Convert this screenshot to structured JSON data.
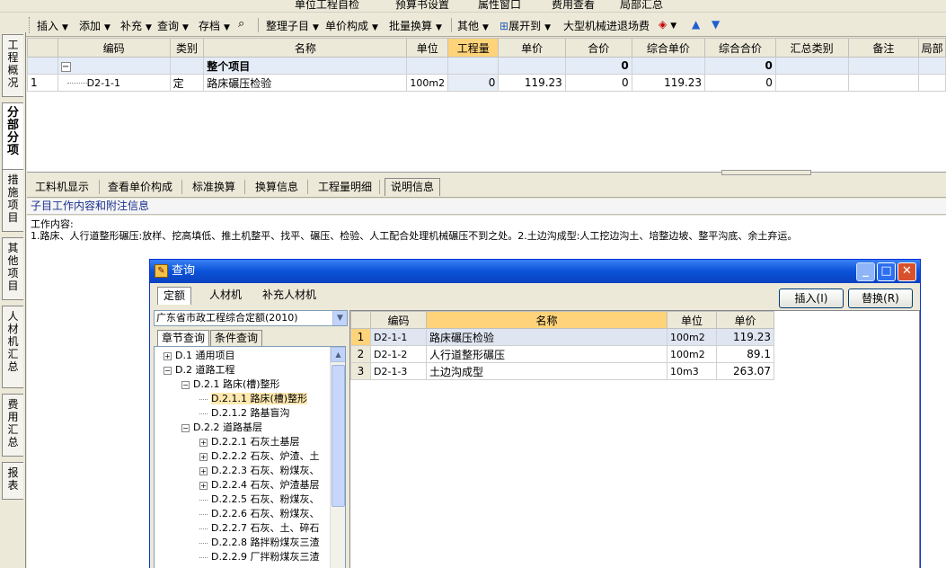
{
  "top_toolbar": {
    "items": [
      "单位工程自检",
      "预算书设置",
      "属性窗口",
      "费用查看",
      "局部汇总"
    ]
  },
  "main_toolbar": {
    "insert": "插入",
    "add": "添加",
    "supplement": "补充",
    "query": "查询",
    "archive": "存档",
    "organize": "整理子目",
    "unit_price_composition": "单价构成",
    "batch_convert": "批量换算",
    "other": "其他",
    "expand_to": "展开到",
    "machinery_fee": "大型机械进退场费"
  },
  "left_tabs": [
    {
      "label": "工程概况"
    },
    {
      "label": "分部分项"
    },
    {
      "label": "措施项目"
    },
    {
      "label": "其他项目"
    },
    {
      "label": "人材机汇总"
    },
    {
      "label": "费用汇总"
    },
    {
      "label": "报表"
    }
  ],
  "main_grid": {
    "columns": [
      "编码",
      "类别",
      "名称",
      "单位",
      "工程量",
      "单价",
      "合价",
      "综合单价",
      "综合合价",
      "汇总类别",
      "备注",
      "局部"
    ],
    "group_row": {
      "name": "整个项目",
      "total": "0",
      "comp_total": "0",
      "toggle": "−"
    },
    "rows": [
      {
        "index": "1",
        "code": "D2-1-1",
        "category": "定",
        "name": "路床碾压检验",
        "unit": "100m2",
        "qty": "0",
        "price": "119.23",
        "total": "0",
        "comp_price": "119.23",
        "comp_total": "0"
      }
    ]
  },
  "bottom_tabs": [
    "工料机显示",
    "查看单价构成",
    "标准换算",
    "换算信息",
    "工程量明细",
    "说明信息"
  ],
  "subtitle": "子目工作内容和附注信息",
  "description": {
    "line1": "工作内容:",
    "line2": "1.路床、人行道整形碾压:放样、挖高填低、推土机整平、找平、碾压、检验、人工配合处理机械碾压不到之处。2.土边沟成型:人工挖边沟土、培整边坡、整平沟底、余土弃运。"
  },
  "dialog": {
    "title": "查询",
    "tabs": [
      "定额",
      "人材机",
      "补充人材机"
    ],
    "insert_button": "插入(I)",
    "replace_button": "替换(R)",
    "quota_library": "广东省市政工程综合定额(2010)",
    "search_tabs": [
      "章节查询",
      "条件查询"
    ],
    "tree": [
      {
        "label": "D.1 通用项目",
        "level": 0,
        "toggle": "+"
      },
      {
        "label": "D.2 道路工程",
        "level": 0,
        "toggle": "−"
      },
      {
        "label": "D.2.1 路床(槽)整形",
        "level": 1,
        "toggle": "−"
      },
      {
        "label": "D.2.1.1 路床(槽)整形",
        "level": 2,
        "toggle": "",
        "selected": true
      },
      {
        "label": "D.2.1.2 路基盲沟",
        "level": 2,
        "toggle": ""
      },
      {
        "label": "D.2.2 道路基层",
        "level": 1,
        "toggle": "−"
      },
      {
        "label": "D.2.2.1 石灰土基层",
        "level": 2,
        "toggle": "+"
      },
      {
        "label": "D.2.2.2 石灰、炉渣、土",
        "level": 2,
        "toggle": "+"
      },
      {
        "label": "D.2.2.3 石灰、粉煤灰、",
        "level": 2,
        "toggle": "+"
      },
      {
        "label": "D.2.2.4 石灰、炉渣基层",
        "level": 2,
        "toggle": "+"
      },
      {
        "label": "D.2.2.5 石灰、粉煤灰、",
        "level": 2,
        "toggle": ""
      },
      {
        "label": "D.2.2.6 石灰、粉煤灰、",
        "level": 2,
        "toggle": ""
      },
      {
        "label": "D.2.2.7 石灰、土、碎石",
        "level": 2,
        "toggle": ""
      },
      {
        "label": "D.2.2.8 路拌粉煤灰三渣",
        "level": 2,
        "toggle": ""
      },
      {
        "label": "D.2.2.9 厂拌粉煤灰三渣",
        "level": 2,
        "toggle": ""
      }
    ],
    "result_columns": [
      "编码",
      "名称",
      "单位",
      "单价"
    ],
    "results": [
      {
        "index": "1",
        "code": "D2-1-1",
        "name": "路床碾压检验",
        "unit": "100m2",
        "price": "119.23"
      },
      {
        "index": "2",
        "code": "D2-1-2",
        "name": "人行道整形碾压",
        "unit": "100m2",
        "price": "89.1"
      },
      {
        "index": "3",
        "code": "D2-1-3",
        "name": "土边沟成型",
        "unit": "10m3",
        "price": "263.07"
      }
    ]
  }
}
